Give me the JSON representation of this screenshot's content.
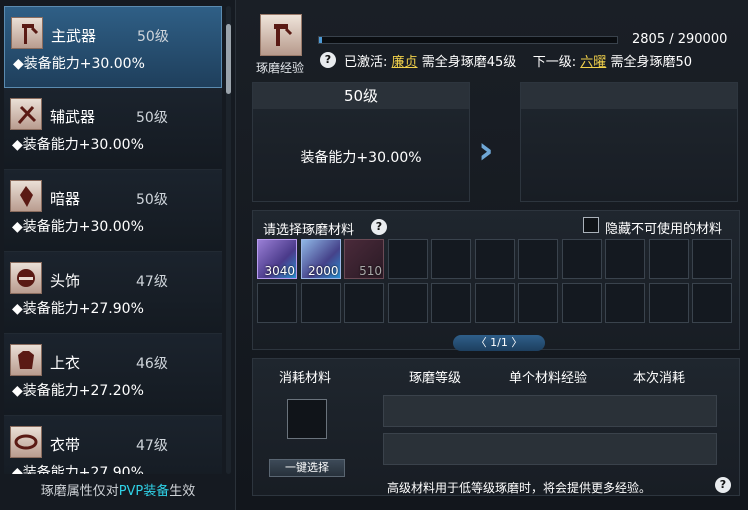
{
  "equipment_list": [
    {
      "name": "主武器",
      "level": "50级",
      "bonus": "◆装备能力+30.00%",
      "icon": "main-weapon-icon",
      "selected": true
    },
    {
      "name": "辅武器",
      "level": "50级",
      "bonus": "◆装备能力+30.00%",
      "icon": "sub-weapon-icon"
    },
    {
      "name": "暗器",
      "level": "50级",
      "bonus": "◆装备能力+30.00%",
      "icon": "hidden-weapon-icon"
    },
    {
      "name": "头饰",
      "level": "47级",
      "bonus": "◆装备能力+27.90%",
      "icon": "headgear-icon"
    },
    {
      "name": "上衣",
      "level": "46级",
      "bonus": "◆装备能力+27.20%",
      "icon": "top-icon"
    },
    {
      "name": "衣带",
      "level": "47级",
      "bonus": "◆装备能力+27.90%",
      "icon": "belt-icon"
    }
  ],
  "footer_note": {
    "prefix": "琢磨属性仅对",
    "highlight": "PVP装备",
    "suffix": "生效"
  },
  "polish": {
    "label": "琢磨经验",
    "exp_text": "2805 / 290000",
    "exp_fraction": 0.0097,
    "help": "?",
    "activated_prefix": "已激活:",
    "activated_name": "廉贞",
    "activated_desc": "需全身琢磨45级",
    "next_prefix": "下一级:",
    "next_name": "六曜",
    "next_desc": "需全身琢磨50"
  },
  "current_level": {
    "title": "50级",
    "bonus": "装备能力+30.00%"
  },
  "next_level": {
    "title": "",
    "bonus": ""
  },
  "materials": {
    "title": "请选择琢磨材料",
    "help": "?",
    "hide_label": "隐藏不可使用的材料",
    "items": [
      {
        "count": "3040",
        "style": "m1"
      },
      {
        "count": "2000",
        "style": "m2"
      },
      {
        "count": "510",
        "style": "m3"
      }
    ],
    "pager": "〈  1/1  〉"
  },
  "consume": {
    "col_material": "消耗材料",
    "col_level": "琢磨等级",
    "col_exp": "单个材料经验",
    "col_cost": "本次消耗",
    "one_key": "一键选择",
    "tip": "高级材料用于低等级琢磨时，将会提供更多经验。",
    "help": "?"
  },
  "colors": {
    "accent": "#4d9ad6",
    "highlight": "#f1d14b",
    "pvp": "#2fd1e6"
  }
}
